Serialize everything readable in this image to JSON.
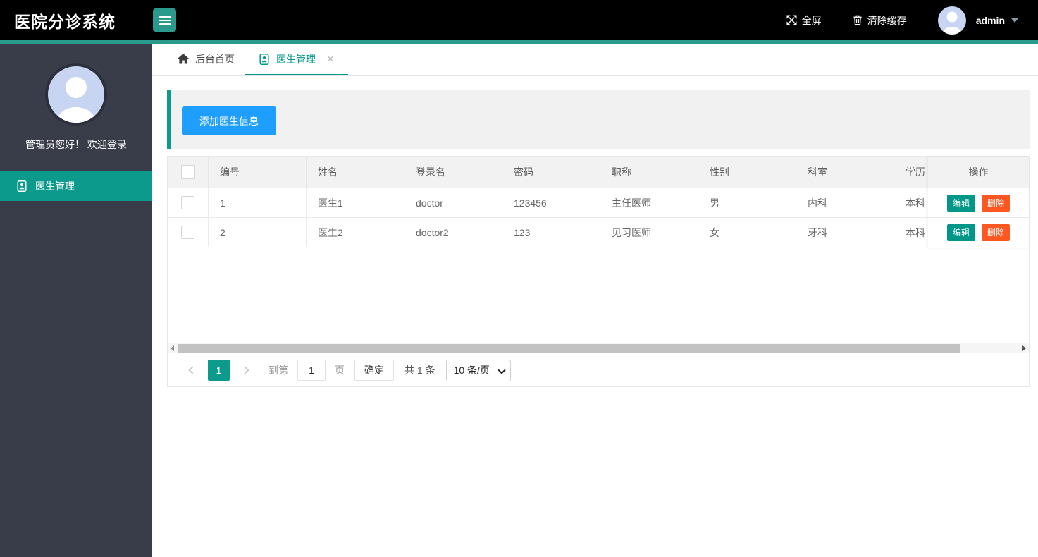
{
  "app": {
    "title": "医院分诊系统"
  },
  "header": {
    "fullscreen": "全屏",
    "clear_cache": "清除缓存",
    "username": "admin"
  },
  "sidebar": {
    "welcome": "管理员您好！ 欢迎登录",
    "menu": [
      {
        "label": "医生管理",
        "active": true
      }
    ]
  },
  "tabs": {
    "home": "后台首页",
    "doctor": "医生管理",
    "close": "×"
  },
  "toolbar": {
    "add_button": "添加医生信息"
  },
  "table": {
    "columns": [
      "编号",
      "姓名",
      "登录名",
      "密码",
      "职称",
      "性别",
      "科室",
      "学历",
      "操作"
    ],
    "rows": [
      {
        "no": "1",
        "name": "医生1",
        "login": "doctor",
        "password": "123456",
        "title": "主任医师",
        "gender": "男",
        "department": "内科",
        "education": "本科"
      },
      {
        "no": "2",
        "name": "医生2",
        "login": "doctor2",
        "password": "123",
        "title": "见习医师",
        "gender": "女",
        "department": "牙科",
        "education": "本科"
      }
    ],
    "actions": {
      "edit": "编辑",
      "delete": "删除"
    }
  },
  "pagination": {
    "current": "1",
    "goto_label": "到第",
    "goto_value": "1",
    "page_label": "页",
    "confirm": "确定",
    "total": "共 1 条",
    "page_size": "10 条/页"
  },
  "icons": {
    "menu": "hamburger",
    "fullscreen": "expand-arrows",
    "clear_cache": "trash",
    "user": "person-silhouette",
    "home": "house",
    "doctor_menu": "id-card",
    "tab_close": "x",
    "caret": "chevron-down"
  },
  "colors": {
    "accent": "#009688",
    "accent_light": "#2a9a8d",
    "primary_blue": "#1E9FFF",
    "danger": "#FF5722",
    "header_bg": "#000000",
    "sidebar_bg": "#393D49",
    "avatar_bg": "#c7d4f2"
  }
}
